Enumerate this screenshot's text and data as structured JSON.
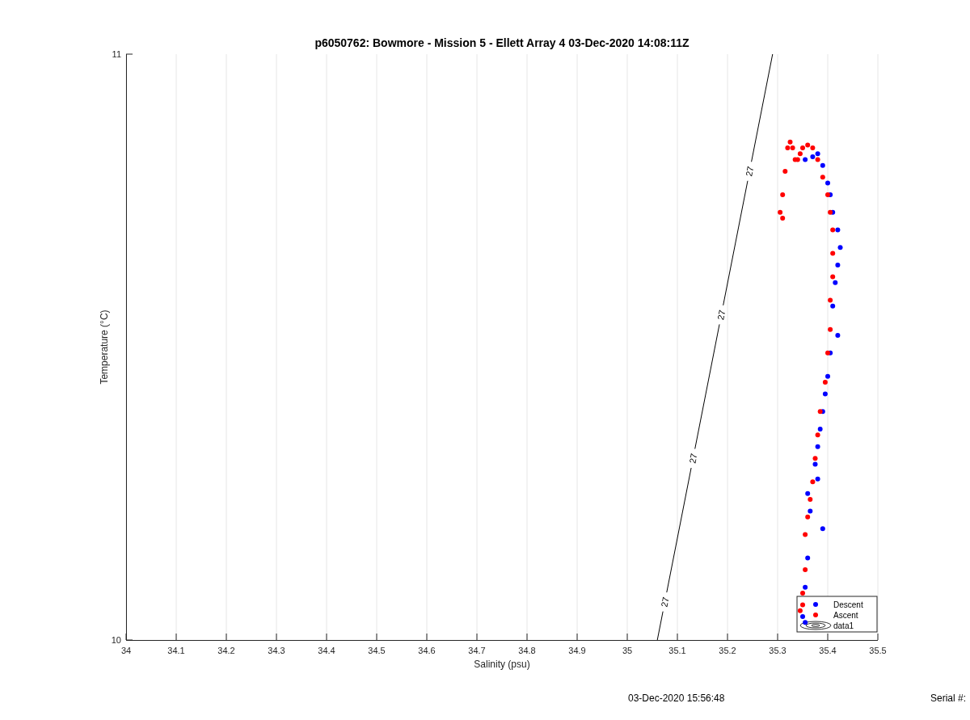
{
  "figure": {
    "chart_data": {
      "type": "scatter",
      "title": "p6050762: Bowmore - Mission 5 - Ellett Array 4 03-Dec-2020 14:08:11Z",
      "xlabel": "Salinity (psu)",
      "ylabel": "Temperature (°C)",
      "xlim": [
        34,
        35.5
      ],
      "ylim": [
        10,
        11
      ],
      "grid": true,
      "legend": true,
      "xticks": [
        34,
        34.1,
        34.2,
        34.3,
        34.4,
        34.5,
        34.6,
        34.7,
        34.8,
        34.9,
        35,
        35.1,
        35.2,
        35.3,
        35.4,
        35.5
      ],
      "yticks": [
        10,
        11
      ],
      "x": [
        35.355,
        35.37,
        35.38,
        35.39,
        35.4,
        35.405,
        35.41,
        35.42,
        35.425,
        35.42,
        35.415,
        35.41,
        35.42,
        35.405,
        35.4,
        35.395,
        35.39,
        35.385,
        35.38,
        35.375,
        35.38,
        35.39,
        35.36,
        35.365,
        35.36,
        35.355,
        35.35,
        35.355,
        35.31,
        35.305,
        35.31,
        35.315,
        35.32,
        35.325,
        35.33,
        35.335,
        35.34,
        35.345,
        35.35,
        35.36,
        35.37,
        35.38,
        35.39,
        35.4,
        35.405,
        35.41,
        35.41,
        35.41,
        35.405,
        35.405,
        35.4,
        35.395,
        35.385,
        35.38,
        35.375,
        35.37,
        35.365,
        35.36,
        35.355,
        35.355,
        35.35,
        35.35,
        35.345,
        35.06,
        35.29
      ],
      "series": [
        {
          "name": "Descent",
          "type": "scatter",
          "color": "#0000ff",
          "values": [
            10.82,
            10.825,
            10.83,
            10.81,
            10.78,
            10.76,
            10.73,
            10.7,
            10.67,
            10.64,
            10.61,
            10.57,
            10.52,
            10.49,
            10.45,
            10.42,
            10.39,
            10.36,
            10.33,
            10.3,
            10.275,
            10.19,
            10.25,
            10.22,
            10.14,
            10.09,
            10.04,
            10.03,
            null,
            null,
            null,
            null,
            null,
            null,
            null,
            null,
            null,
            null,
            null,
            null,
            null,
            null,
            null,
            null,
            null,
            null,
            null,
            null,
            null,
            null,
            null,
            null,
            null,
            null,
            null,
            null,
            null,
            null,
            null,
            null,
            null,
            null,
            null,
            null,
            null
          ]
        },
        {
          "name": "Ascent",
          "type": "scatter",
          "color": "#ff0000",
          "values": [
            null,
            null,
            null,
            null,
            null,
            null,
            null,
            null,
            null,
            null,
            null,
            null,
            null,
            null,
            null,
            null,
            null,
            null,
            null,
            null,
            null,
            null,
            null,
            null,
            null,
            null,
            null,
            null,
            10.72,
            10.73,
            10.76,
            10.8,
            10.84,
            10.85,
            10.84,
            10.82,
            10.82,
            10.83,
            10.84,
            10.845,
            10.84,
            10.82,
            10.79,
            10.76,
            10.73,
            10.7,
            10.66,
            10.62,
            10.58,
            10.53,
            10.49,
            10.44,
            10.39,
            10.35,
            10.31,
            10.27,
            10.24,
            10.21,
            10.18,
            10.12,
            10.08,
            10.06,
            10.05,
            null,
            null
          ]
        },
        {
          "name": "data1",
          "type": "line",
          "color": "#000000",
          "values": [
            null,
            null,
            null,
            null,
            null,
            null,
            null,
            null,
            null,
            null,
            null,
            null,
            null,
            null,
            null,
            null,
            null,
            null,
            null,
            null,
            null,
            null,
            null,
            null,
            null,
            null,
            null,
            null,
            null,
            null,
            null,
            null,
            null,
            null,
            null,
            null,
            null,
            null,
            null,
            null,
            null,
            null,
            null,
            null,
            null,
            null,
            null,
            null,
            null,
            null,
            null,
            null,
            null,
            null,
            null,
            null,
            null,
            null,
            null,
            null,
            null,
            null,
            null,
            10,
            11
          ]
        }
      ],
      "annotations": [
        "27",
        "27",
        "27",
        "27"
      ]
    },
    "footer": {
      "timestamp": "03-Dec-2020 15:56:48",
      "serial_label": "Serial #:"
    }
  }
}
